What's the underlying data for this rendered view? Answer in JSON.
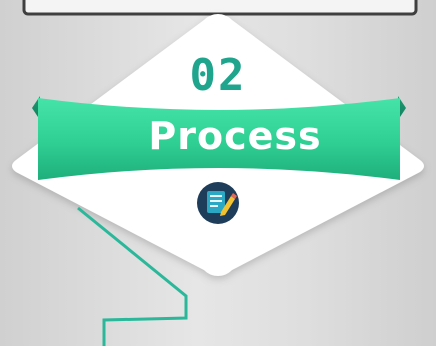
{
  "step": {
    "number": "02",
    "title": "Process",
    "icon": "document-edit-icon"
  },
  "colors": {
    "background": "#dcdcdc",
    "accent_green": "#2bd79a",
    "accent_dark_green": "#1fa58d",
    "diamond": "#ffffff",
    "icon_circle": "#1d3d5a"
  }
}
